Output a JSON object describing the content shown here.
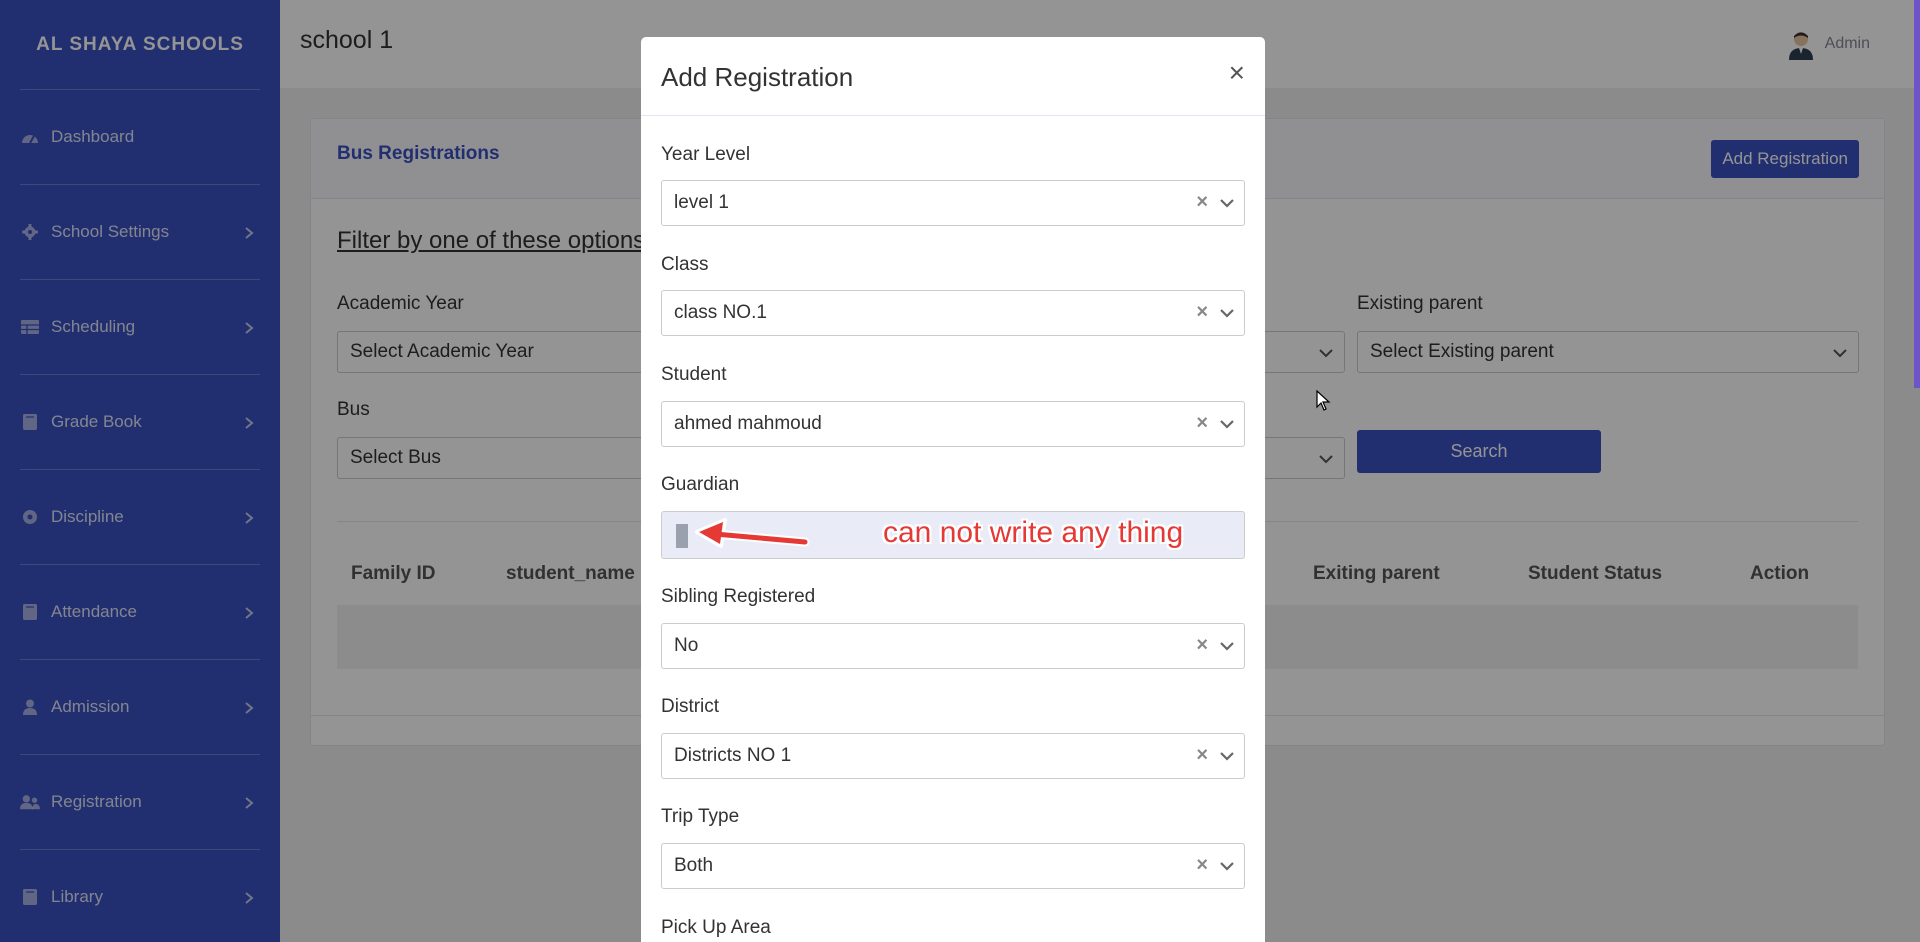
{
  "sidebar": {
    "brand": "AL SHAYA SCHOOLS",
    "items": [
      {
        "label": "Dashboard",
        "icon": "dashboard-icon",
        "has_chevron": false
      },
      {
        "label": "School Settings",
        "icon": "gear-icon",
        "has_chevron": true
      },
      {
        "label": "Scheduling",
        "icon": "table-icon",
        "has_chevron": true
      },
      {
        "label": "Grade Book",
        "icon": "book-icon",
        "has_chevron": true
      },
      {
        "label": "Discipline",
        "icon": "circle-icon",
        "has_chevron": true
      },
      {
        "label": "Attendance",
        "icon": "book-icon",
        "has_chevron": true
      },
      {
        "label": "Admission",
        "icon": "user-icon",
        "has_chevron": true
      },
      {
        "label": "Registration",
        "icon": "users-icon",
        "has_chevron": true
      },
      {
        "label": "Library",
        "icon": "book-icon",
        "has_chevron": true
      }
    ]
  },
  "topbar": {
    "school": "school 1",
    "user": "Admin"
  },
  "card": {
    "title": "Bus Registrations",
    "add_button": "Add Registration",
    "filter_title": "Filter by one of these options",
    "filters": {
      "academic_year_label": "Academic Year",
      "academic_year_value": "Select Academic Year",
      "existing_parent_label": "Existing parent",
      "existing_parent_value": "Select Existing parent",
      "bus_label": "Bus",
      "bus_value": "Select Bus"
    },
    "search_button": "Search",
    "table_headers": [
      "Family ID",
      "student_name",
      "Exiting parent",
      "Student Status",
      "Action"
    ]
  },
  "modal": {
    "title": "Add Registration",
    "close": "×",
    "fields": {
      "year_level_label": "Year Level",
      "year_level_value": "level 1",
      "class_label": "Class",
      "class_value": "class NO.1",
      "student_label": "Student",
      "student_value": "ahmed mahmoud",
      "guardian_label": "Guardian",
      "sibling_label": "Sibling Registered",
      "sibling_value": "No",
      "district_label": "District",
      "district_value": "Districts NO 1",
      "trip_type_label": "Trip Type",
      "trip_type_value": "Both",
      "pickup_label": "Pick Up Area"
    },
    "clear_glyph": "×",
    "annotation": "can not write any thing"
  },
  "colors": {
    "primary": "#3a50c2",
    "annotation": "#e53935",
    "overlay": "rgba(0,0,0,0.42)"
  }
}
